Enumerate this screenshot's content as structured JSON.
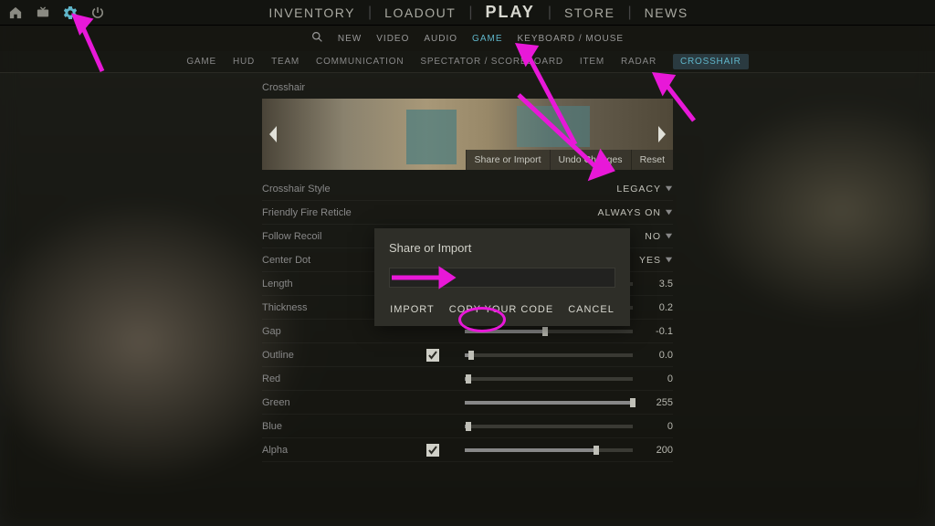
{
  "mainnav": {
    "inventory": "INVENTORY",
    "loadout": "LOADOUT",
    "play": "PLAY",
    "store": "STORE",
    "news": "NEWS"
  },
  "subnav": {
    "new": "NEW",
    "video": "VIDEO",
    "audio": "AUDIO",
    "game": "GAME",
    "keyboard_mouse": "KEYBOARD / MOUSE"
  },
  "subtabs": {
    "game": "GAME",
    "hud": "HUD",
    "team": "TEAM",
    "communication": "COMMUNICATION",
    "spectator": "SPECTATOR / SCOREBOARD",
    "item": "ITEM",
    "radar": "RADAR",
    "crosshair": "CROSSHAIR"
  },
  "section": {
    "title": "Crosshair"
  },
  "preview_actions": {
    "share": "Share or Import",
    "undo": "Undo Changes",
    "reset": "Reset"
  },
  "settings": [
    {
      "key": "crosshair_style",
      "label": "Crosshair Style",
      "type": "drop",
      "value": "LEGACY"
    },
    {
      "key": "friendly_fire",
      "label": "Friendly Fire Reticle",
      "type": "drop",
      "value": "ALWAYS ON"
    },
    {
      "key": "follow_recoil",
      "label": "Follow Recoil",
      "type": "drop",
      "value": "NO"
    },
    {
      "key": "center_dot",
      "label": "Center Dot",
      "type": "drop",
      "value": "YES"
    },
    {
      "key": "length",
      "label": "Length",
      "type": "slider",
      "value": "3.5",
      "pct": 22
    },
    {
      "key": "thickness",
      "label": "Thickness",
      "type": "slider",
      "value": "0.2",
      "pct": 5
    },
    {
      "key": "gap",
      "label": "Gap",
      "type": "slider",
      "value": "-0.1",
      "pct": 48
    },
    {
      "key": "outline",
      "label": "Outline",
      "type": "check_slider",
      "value": "0.0",
      "pct": 4,
      "checked": true
    },
    {
      "key": "red",
      "label": "Red",
      "type": "slider",
      "value": "0",
      "pct": 2
    },
    {
      "key": "green",
      "label": "Green",
      "type": "slider",
      "value": "255",
      "pct": 100
    },
    {
      "key": "blue",
      "label": "Blue",
      "type": "slider",
      "value": "0",
      "pct": 2
    },
    {
      "key": "alpha",
      "label": "Alpha",
      "type": "check_slider",
      "value": "200",
      "pct": 78,
      "checked": true
    }
  ],
  "modal": {
    "title": "Share or Import",
    "input_value": "",
    "import": "IMPORT",
    "copy": "COPY YOUR CODE",
    "cancel": "CANCEL"
  }
}
